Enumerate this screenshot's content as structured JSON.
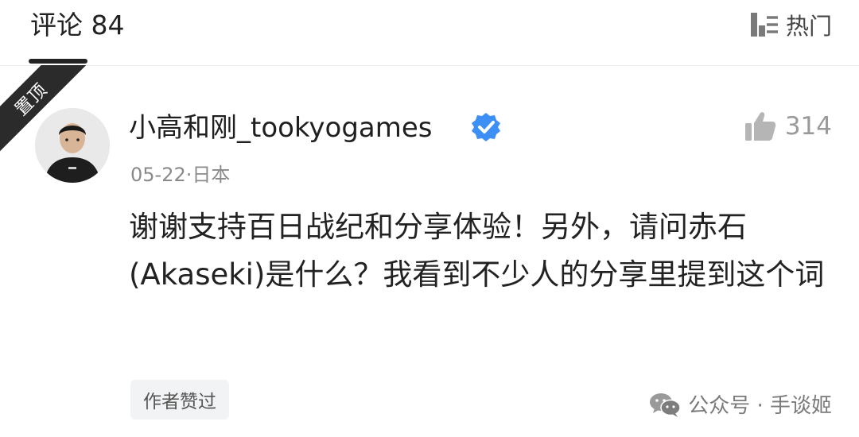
{
  "header": {
    "title": "评论 84",
    "sort_label": "热门",
    "sort_icon": "sort-icon"
  },
  "comment": {
    "pinned_label": "置顶",
    "username": "小高和刚_tookyogames",
    "verified_icon": "verified-badge-icon",
    "verified_color": "#3b8ff5",
    "like_count": "314",
    "meta": "05-22·日本",
    "text": "谢谢支持百日战纪和分享体验！另外，请问赤石(Akaseki)是什么？我看到不少人的分享里提到这个词",
    "author_tag": "作者赞过"
  },
  "watermark": {
    "text": "公众号 · 手谈姬",
    "icon": "wechat-icon"
  }
}
